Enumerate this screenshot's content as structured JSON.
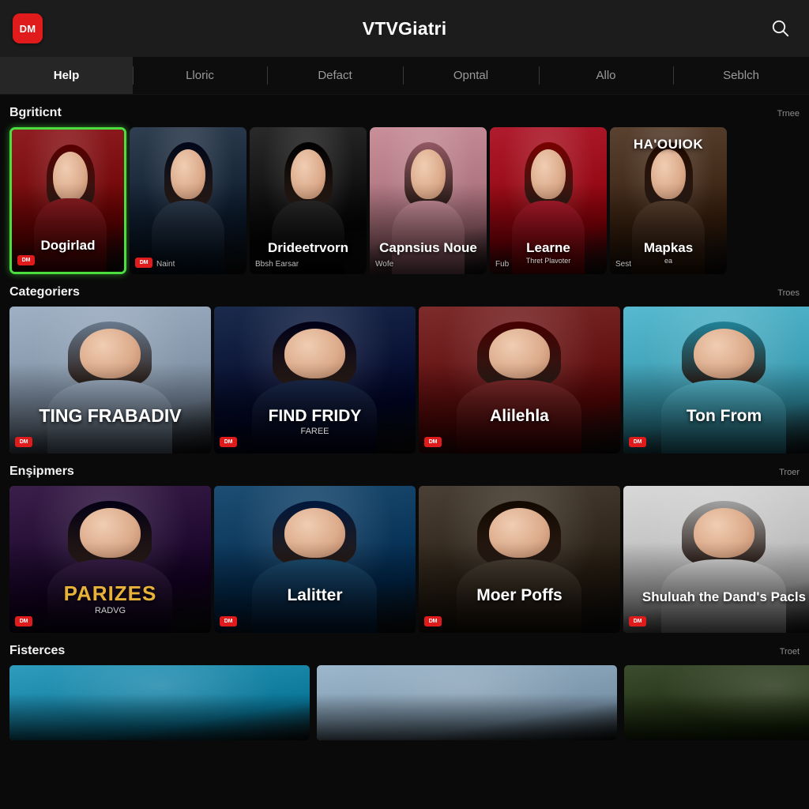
{
  "header": {
    "logo_text": "DM",
    "logo_color": "#e01b1b",
    "app_title": "VTVGiatri",
    "search_icon": "search-icon"
  },
  "tabs": [
    {
      "label": "Help",
      "active": true
    },
    {
      "label": "Lloric",
      "active": false
    },
    {
      "label": "Defact",
      "active": false
    },
    {
      "label": "Opntal",
      "active": false
    },
    {
      "label": "Allo",
      "active": false
    },
    {
      "label": "Seblch",
      "active": false
    }
  ],
  "rows": [
    {
      "title": "Bgriticnt",
      "more": "Trnee",
      "cards": [
        {
          "title": "Dogirlad",
          "subtitle": "",
          "topline": "",
          "side_label": "",
          "badge": "DM",
          "selected": true,
          "accent": "#8f1d22"
        },
        {
          "title": "",
          "subtitle": "",
          "topline": "",
          "side_label": "Naint",
          "badge": "DM",
          "selected": false,
          "accent": "#2f3e50"
        },
        {
          "title": "Drideetrvorn",
          "subtitle": "",
          "topline": "",
          "side_label": "Bbsh   Earsar",
          "badge": "",
          "selected": false,
          "accent": "#2a2a2a"
        },
        {
          "title": "Capnsius Noue",
          "subtitle": "",
          "topline": "",
          "side_label": "Wofe",
          "badge": "",
          "selected": false,
          "accent": "#c98f9a"
        },
        {
          "title": "Learne",
          "subtitle": "Thret Plavoter",
          "topline": "",
          "side_label": "Fub",
          "badge": "",
          "selected": false,
          "accent": "#b01c2e"
        },
        {
          "title": "Mapkas",
          "subtitle": "ea",
          "topline": "HA'OUIOK",
          "side_label": "Sest",
          "badge": "",
          "selected": false,
          "accent": "#5a4231"
        }
      ]
    },
    {
      "title": "Categoriers",
      "more": "Troes",
      "cards": [
        {
          "title": "TING FRABADIV",
          "subtitle": "",
          "topline": "",
          "side_label": "",
          "badge": "DM",
          "selected": false,
          "accent": "#9fb0c4"
        },
        {
          "title": "FIND FRIDY",
          "subtitle": "FAREE",
          "topline": "",
          "side_label": "",
          "badge": "DM",
          "selected": false,
          "accent": "#1b2b4d"
        },
        {
          "title": "Alilehla",
          "subtitle": "",
          "topline": "",
          "side_label": "",
          "badge": "DM",
          "selected": false,
          "accent": "#7d2b2b"
        },
        {
          "title": "Ton From",
          "subtitle": "",
          "topline": "",
          "side_label": "",
          "badge": "DM",
          "selected": false,
          "accent": "#57b9cf"
        }
      ]
    },
    {
      "title": "Enşipmers",
      "more": "Troer",
      "cards": [
        {
          "title": "PARIZES",
          "subtitle": "RADVG",
          "topline": "",
          "side_label": "",
          "badge": "DM",
          "selected": false,
          "accent": "#3a1f4a"
        },
        {
          "title": "Lalitter",
          "subtitle": "",
          "topline": "",
          "side_label": "",
          "badge": "DM",
          "selected": false,
          "accent": "#1d4e73"
        },
        {
          "title": "Moer Poffs",
          "subtitle": "",
          "topline": "",
          "side_label": "",
          "badge": "DM",
          "selected": false,
          "accent": "#4a4035"
        },
        {
          "title": "Shuluah the Dand's Pacls",
          "subtitle": "",
          "topline": "",
          "side_label": "",
          "badge": "DM",
          "selected": false,
          "accent": "#d8d8d8"
        }
      ]
    },
    {
      "title": "Fisterces",
      "more": "Troet",
      "cards": [
        {
          "title": "",
          "subtitle": "",
          "topline": "",
          "side_label": "",
          "badge": "",
          "selected": false,
          "accent": "#2f9bbd"
        },
        {
          "title": "",
          "subtitle": "",
          "topline": "",
          "side_label": "",
          "badge": "",
          "selected": false,
          "accent": "#9db7cc"
        },
        {
          "title": "",
          "subtitle": "",
          "topline": "",
          "side_label": "",
          "badge": "",
          "selected": false,
          "accent": "#3c4c2e"
        }
      ]
    }
  ]
}
